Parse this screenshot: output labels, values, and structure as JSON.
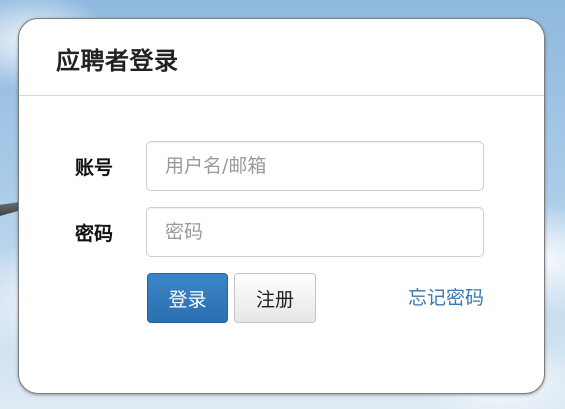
{
  "login_card": {
    "title": "应聘者登录",
    "account_label": "账号",
    "account_placeholder": "用户名/邮箱",
    "account_value": "",
    "password_label": "密码",
    "password_placeholder": "密码",
    "password_value": "",
    "login_button": "登录",
    "register_button": "注册",
    "forgot_link": "忘记密码"
  },
  "colors": {
    "primary_button": "#2f78bb",
    "link": "#3a78b4",
    "sky": "#a9cbe8"
  }
}
